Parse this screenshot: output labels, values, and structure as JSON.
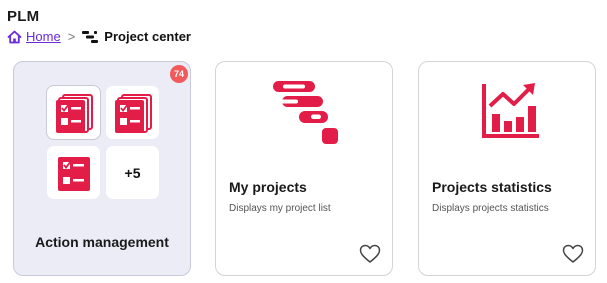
{
  "app": {
    "title": "PLM"
  },
  "breadcrumb": {
    "home_label": "Home",
    "current_label": "Project center"
  },
  "colors": {
    "accent_red": "#e11d48",
    "link_purple": "#6a2bd9",
    "badge_red": "#f15a5a",
    "highlight_bg": "#ececf7"
  },
  "cards": [
    {
      "title": "Action management",
      "badge": "74",
      "more_label": "+5",
      "icon": "checklist-icon"
    },
    {
      "title": "My projects",
      "description": "Displays my project list",
      "icon": "gantt-icon"
    },
    {
      "title": "Projects statistics",
      "description": "Displays projects statistics",
      "icon": "bar-chart-growth-icon"
    }
  ]
}
